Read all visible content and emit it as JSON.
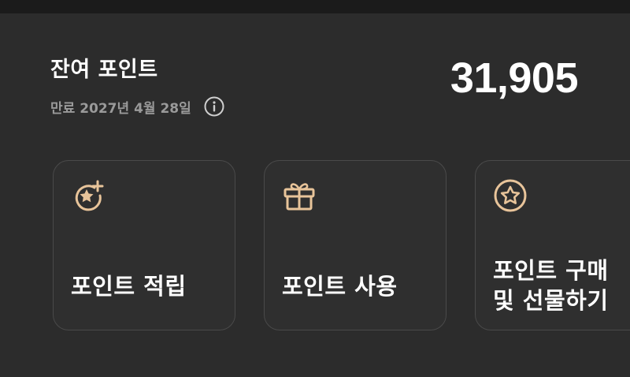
{
  "header": {
    "title": "잔여 포인트",
    "expiry": "만료 2027년 4월 28일",
    "balance": "31,905"
  },
  "icons": {
    "info": "info-circle-icon",
    "earn": "star-plus-icon",
    "use": "gift-box-icon",
    "buy": "star-circle-icon"
  },
  "colors": {
    "background": "#2c2c2c",
    "card_border": "#4a4a4a",
    "icon_accent": "#e8c49a",
    "muted_text": "#9a9a9a"
  },
  "cards": [
    {
      "label": "포인트 적립"
    },
    {
      "label": "포인트 사용"
    },
    {
      "label_line1": "포인트 구매",
      "label_line2": "및 선물하기"
    }
  ]
}
